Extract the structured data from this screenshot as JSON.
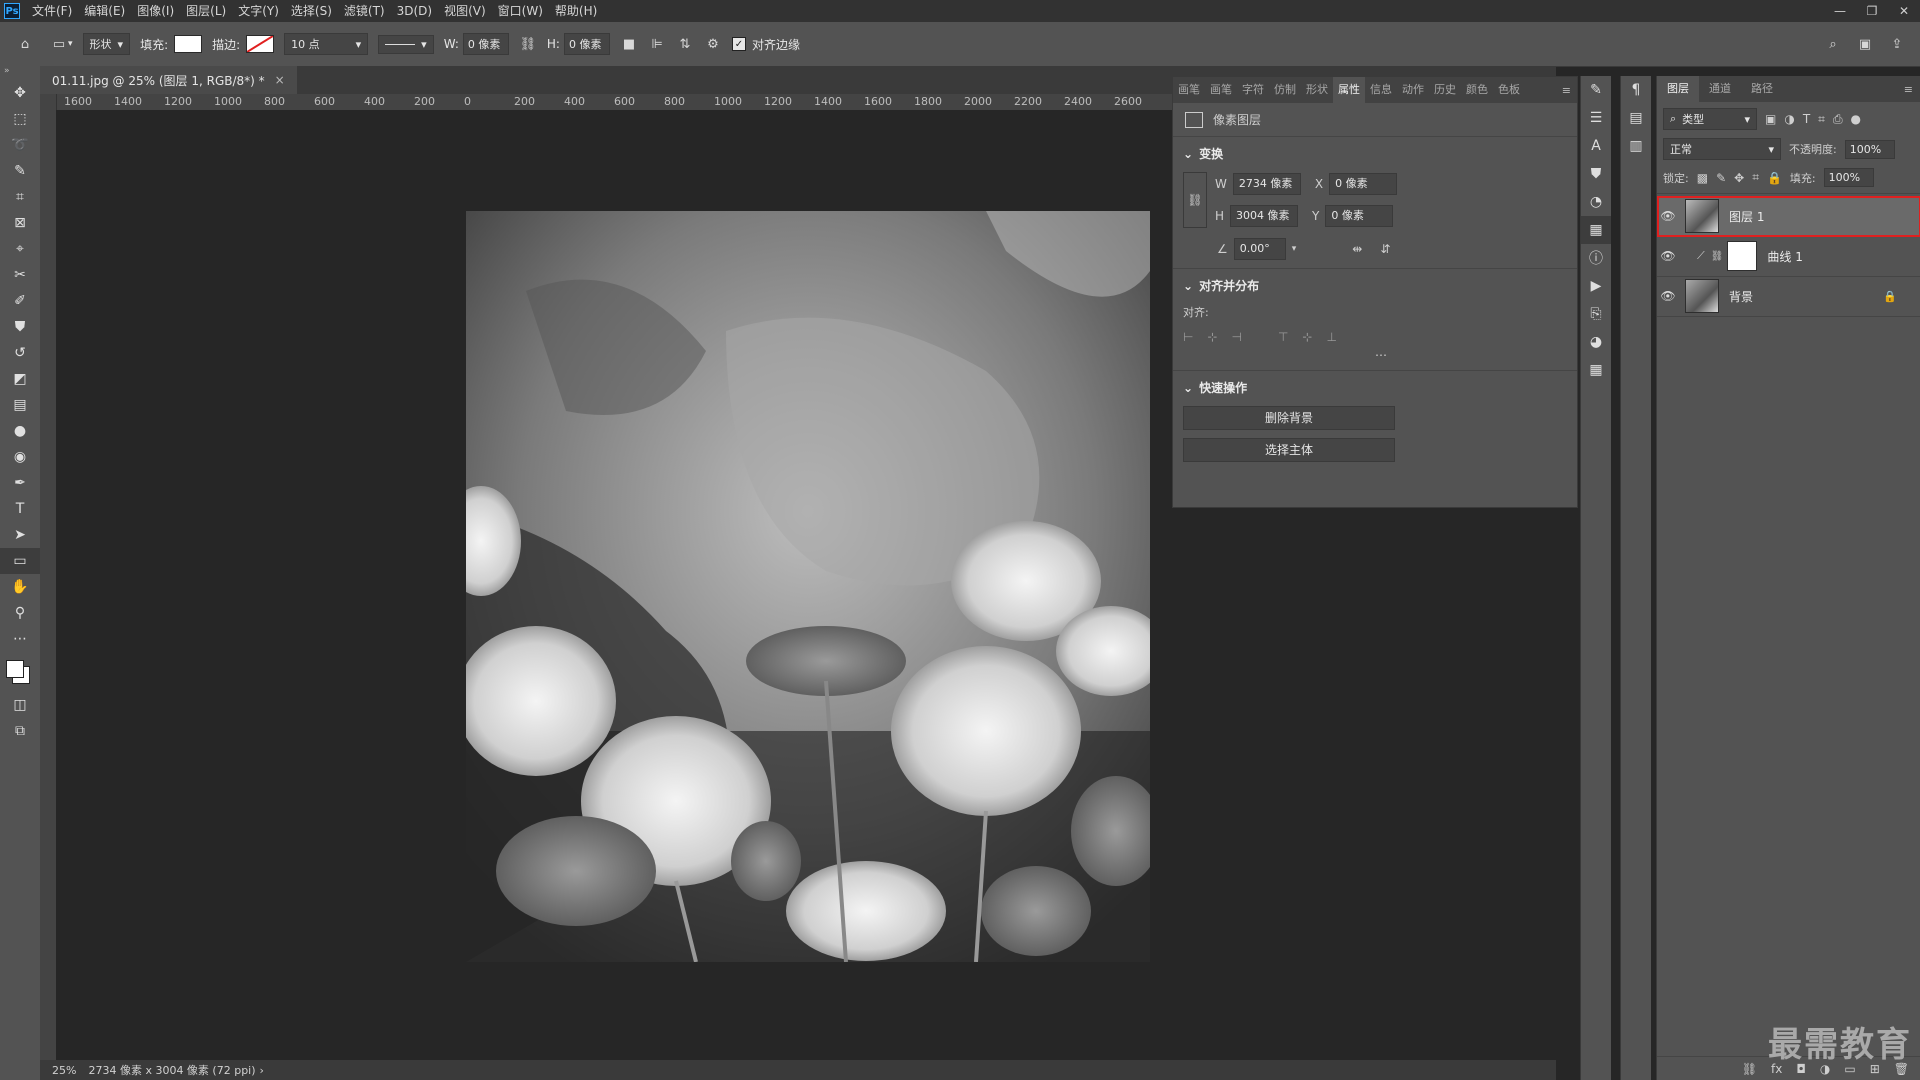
{
  "menubar": {
    "app_icon": "Ps",
    "items": [
      "文件(F)",
      "编辑(E)",
      "图像(I)",
      "图层(L)",
      "文字(Y)",
      "选择(S)",
      "滤镜(T)",
      "3D(D)",
      "视图(V)",
      "窗口(W)",
      "帮助(H)"
    ]
  },
  "options": {
    "mode": "形状",
    "fill_label": "填充:",
    "stroke_label": "描边:",
    "stroke_size": "10 点",
    "w_label": "W:",
    "w_value": "0 像素",
    "h_label": "H:",
    "h_value": "0 像素",
    "align_edges_label": "对齐边缘",
    "fill_color": "#ffffff"
  },
  "document": {
    "tab_title": "01.11.jpg @ 25% (图层 1, RGB/8*) *",
    "status_zoom": "25%",
    "status_info": "2734 像素 x 3004 像素 (72 ppi)"
  },
  "ruler": {
    "labels": [
      "1600",
      "1400",
      "1200",
      "1000",
      "800",
      "600",
      "400",
      "200",
      "0",
      "200",
      "400",
      "600",
      "800",
      "1000",
      "1200",
      "1400",
      "1600",
      "1800",
      "2000",
      "2200",
      "2400",
      "2600"
    ]
  },
  "properties": {
    "tabs": [
      "画笔",
      "画笔",
      "字符",
      "仿制",
      "形状",
      "属性",
      "信息",
      "动作",
      "历史",
      "颜色",
      "色板"
    ],
    "active_tab": "属性",
    "layer_type": "像素图层",
    "transform_title": "变换",
    "w_label": "W",
    "w_value": "2734 像素",
    "x_label": "X",
    "x_value": "0 像素",
    "h_label": "H",
    "h_value": "3004 像素",
    "y_label": "Y",
    "y_value": "0 像素",
    "angle": "0.00°",
    "align_title": "对齐并分布",
    "align_label": "对齐:",
    "quick_title": "快速操作",
    "btn_remove_bg": "删除背景",
    "btn_select_subject": "选择主体"
  },
  "layers_panel": {
    "tabs": [
      "图层",
      "通道",
      "路径"
    ],
    "filter_type": "类型",
    "blend_mode": "正常",
    "opacity_label": "不透明度:",
    "opacity_value": "100%",
    "lock_label": "锁定:",
    "fill_label": "填充:",
    "fill_value": "100%",
    "layers": [
      {
        "name": "图层 1",
        "selected": true
      },
      {
        "name": "曲线 1",
        "selected": false
      },
      {
        "name": "背景",
        "selected": false
      }
    ]
  },
  "watermark": "最需教育"
}
